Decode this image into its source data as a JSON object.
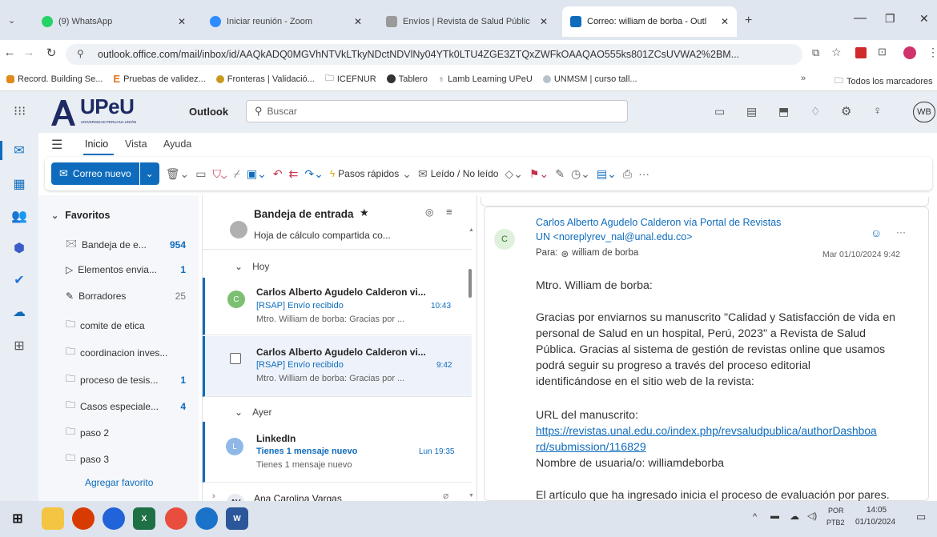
{
  "browser": {
    "tabs": [
      {
        "label": "(9) WhatsApp",
        "color": "#25d366"
      },
      {
        "label": "Iniciar reunión - Zoom",
        "color": "#2d8cff"
      },
      {
        "label": "Envíos | Revista de Salud Públic",
        "color": "#8a8a8a"
      },
      {
        "label": "Correo: william de borba - Outl",
        "color": "#0f6cbd"
      }
    ],
    "new_tab": "+",
    "url": "outlook.office.com/mail/inbox/id/AAQkADQ0MGVhNTVkLTkyNDctNDVlNy04YTk0LTU4ZGE3ZTQxZWFkOAAQAO555ks801ZCsUVWA2%2BM...",
    "bookmarks": [
      "Record. Building Se...",
      "Pruebas de validez...",
      "Fronteras | Validació...",
      "ICEFNUR",
      "Tablero",
      "Lamb Learning UPeU",
      "UNMSM | curso tall..."
    ],
    "bookmarks_more": "»",
    "all_bookmarks": "Todos los marcadores"
  },
  "outlook": {
    "brand": "UPeU",
    "brand_sub": "UNIVERSIDAD PERUANA UNIÓN",
    "app_name": "Outlook",
    "search_placeholder": "Buscar",
    "user_initials": "WB",
    "ribbon_tabs": [
      "Inicio",
      "Vista",
      "Ayuda"
    ],
    "new_mail": "Correo nuevo",
    "quick_steps": "Pasos rápidos",
    "read_unread": "Leído / No leído",
    "more": "···"
  },
  "folders": {
    "favorites_label": "Favoritos",
    "items": [
      {
        "label": "Bandeja de e...",
        "count": "954"
      },
      {
        "label": "Elementos envia...",
        "count": "1"
      },
      {
        "label": "Borradores",
        "count": "25"
      },
      {
        "label": "comite de etica",
        "count": ""
      },
      {
        "label": "coordinacion inves...",
        "count": ""
      },
      {
        "label": "proceso de tesis...",
        "count": "1"
      },
      {
        "label": "Casos especiale...",
        "count": "4"
      },
      {
        "label": "paso 2",
        "count": ""
      },
      {
        "label": "paso 3",
        "count": ""
      }
    ],
    "add_favorite": "Agregar favorito"
  },
  "messages": {
    "header": "Bandeja de entrada",
    "partial_preview": "Hoja de cálculo compartida co...",
    "group_today": "Hoy",
    "group_yesterday": "Ayer",
    "items": [
      {
        "initial": "C",
        "from": "Carlos Alberto Agudelo Calderon vi...",
        "subject": "[RSAP] Envío recibido",
        "time": "10:43",
        "preview": "Mtro. William de borba: Gracias por ..."
      },
      {
        "initial": "",
        "from": "Carlos Alberto Agudelo Calderon vi...",
        "subject": "[RSAP] Envío recibido",
        "time": "9:42",
        "preview": "Mtro. William de borba: Gracias por ..."
      },
      {
        "initial": "L",
        "from": "LinkedIn",
        "subject": "Tienes 1 mensaje nuevo",
        "time": "Lun 19:35",
        "preview": "Tienes 1 mensaje nuevo"
      },
      {
        "initial": "AV",
        "from": "Ana Carolina Vargas",
        "subject": "",
        "time": "",
        "preview": ""
      }
    ]
  },
  "reading": {
    "sender_line1": "Carlos Alberto Agudelo Calderon vía Portal de Revistas",
    "sender_line2": "UN <noreplyrev_nal@unal.edu.co>",
    "sender_initial": "C",
    "to_label": "Para:",
    "to_name": "william de borba",
    "date": "Mar 01/10/2024 9:42",
    "greeting": "Mtro. William de borba:",
    "para1_l1": "Gracias por enviarnos su manuscrito \"Calidad y Satisfacción de vida en",
    "para1_l2": "personal de Salud en un hospital, Perú, 2023\" a Revista de Salud",
    "para1_l3": "Pública. Gracias al sistema de gestión de revistas online que usamos",
    "para1_l4": "podrá seguir su progreso a través del proceso editorial",
    "para1_l5": "identificándose en el sitio web de la revista:",
    "url_label": "URL del manuscrito:",
    "url_l1": "https://revistas.unal.edu.co/index.php/revsaludpublica/authorDashboa",
    "url_l2": "rd/submission/116829",
    "username": "Nombre de usuaria/o: williamdeborba",
    "para2": "El artículo que ha ingresado inicia el proceso de evaluación por pares."
  },
  "taskbar": {
    "lang1": "POR",
    "lang2": "PTB2",
    "time": "14:05",
    "date": "01/10/2024"
  }
}
